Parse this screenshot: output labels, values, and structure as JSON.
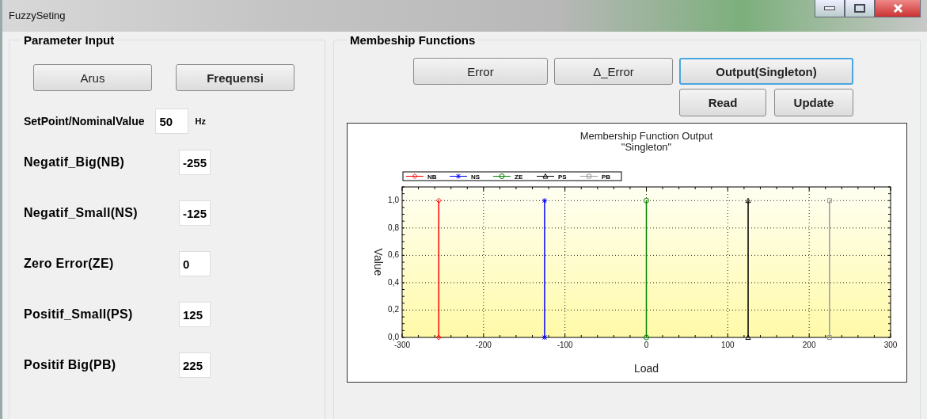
{
  "window": {
    "title": "FuzzySeting"
  },
  "parameter_input": {
    "title": "Parameter Input",
    "mode_buttons": [
      {
        "label": "Arus",
        "selected": false
      },
      {
        "label": "Frequensi",
        "selected": true
      }
    ],
    "setpoint": {
      "label": "SetPoint/NominalValue",
      "value": "50",
      "unit": "Hz"
    },
    "fields": [
      {
        "label": "Negatif_Big(NB)",
        "value": "-255"
      },
      {
        "label": "Negatif_Small(NS)",
        "value": "-125"
      },
      {
        "label": "Zero  Error(ZE)",
        "value": "0"
      },
      {
        "label": "Positif_Small(PS)",
        "value": "125"
      },
      {
        "label": "Positif  Big(PB)",
        "value": "225"
      }
    ]
  },
  "membership": {
    "title": "Membeship  Functions",
    "tabs": [
      {
        "label": "Error",
        "selected": false
      },
      {
        "label": "Δ_Error",
        "selected": false
      },
      {
        "label": "Output(Singleton)",
        "selected": true
      }
    ],
    "actions": [
      "Read",
      "Update"
    ],
    "chart_data": {
      "type": "line",
      "title": "Membership Function Output\n\"Singleton\"",
      "xlabel": "Load",
      "ylabel": "Value",
      "legend": true,
      "grid": true,
      "series": [
        {
          "name": "NB",
          "color": "#ff0000",
          "marker": "diamond",
          "x": [
            -255,
            -255
          ],
          "values": [
            0,
            1
          ]
        },
        {
          "name": "NS",
          "color": "#0000ff",
          "marker": "cross",
          "x": [
            -125,
            -125
          ],
          "values": [
            0,
            1
          ]
        },
        {
          "name": "ZE",
          "color": "#008000",
          "marker": "circle",
          "x": [
            0,
            0
          ],
          "values": [
            0,
            1
          ]
        },
        {
          "name": "PS",
          "color": "#000000",
          "marker": "triangle",
          "x": [
            125,
            125
          ],
          "values": [
            0,
            1
          ]
        },
        {
          "name": "PB",
          "color": "#999999",
          "marker": "square",
          "x": [
            225,
            225
          ],
          "values": [
            0,
            1
          ]
        }
      ],
      "xlim": [
        -300,
        300
      ],
      "ylim": [
        0,
        1.1
      ],
      "xticks": [
        -300,
        -200,
        -100,
        0,
        100,
        200,
        300
      ],
      "yticks": [
        {
          "value": 0,
          "label": "0,0"
        },
        {
          "value": 0.2,
          "label": "0,2"
        },
        {
          "value": 0.4,
          "label": "0,4"
        },
        {
          "value": 0.6,
          "label": "0,6"
        },
        {
          "value": 0.8,
          "label": "0,8"
        },
        {
          "value": 1,
          "label": "1,0"
        }
      ]
    }
  }
}
